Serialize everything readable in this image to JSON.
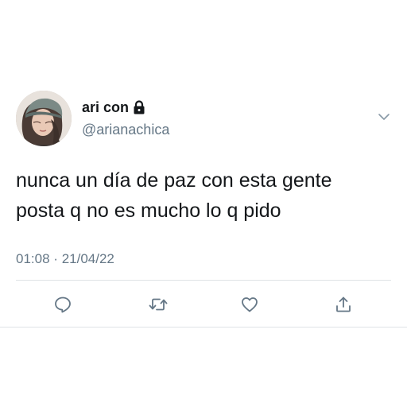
{
  "user": {
    "display_name": "ari con",
    "handle": "@arianachica",
    "avatar": "profile-photo",
    "protected_icon": "lock-icon"
  },
  "tweet": {
    "lines": [
      "nunca un día de paz con esta gente",
      "posta q no es mucho lo q pido"
    ],
    "time": "01:08",
    "separator": "·",
    "date": "21/04/22"
  },
  "actions": {
    "reply": "reply-icon",
    "retweet": "retweet-icon",
    "like": "heart-icon",
    "share": "share-icon",
    "menu": "chevron-down-icon"
  },
  "colors": {
    "text": "#14171a",
    "secondary": "#657786",
    "divider": "#dfe3e6"
  }
}
